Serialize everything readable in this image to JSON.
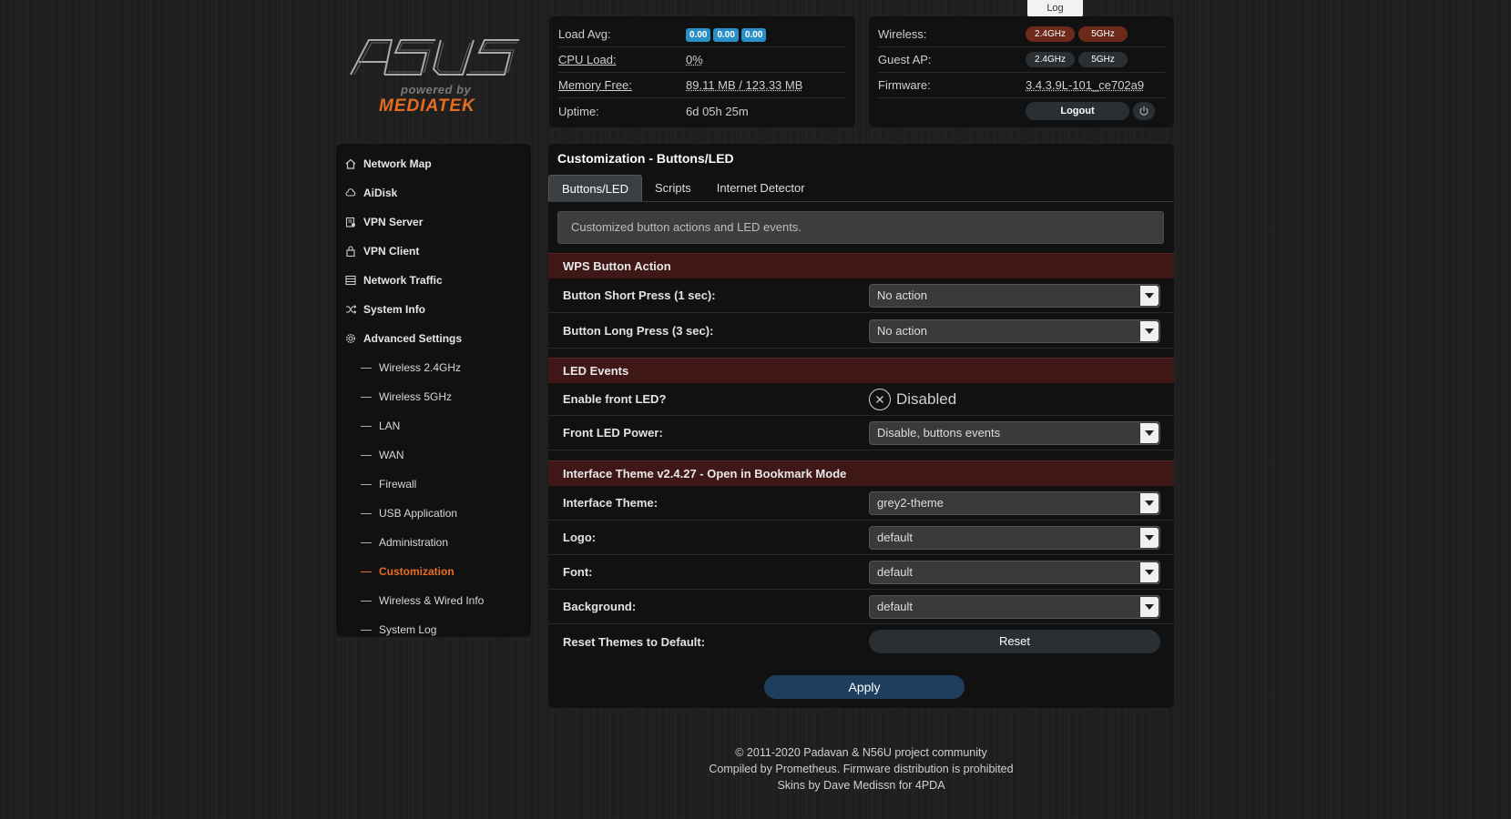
{
  "log_tab": "Log",
  "logo": {
    "brand": "ASUS",
    "powered_by": "powered by",
    "mediatek": "MEDIATEK"
  },
  "status": {
    "load_avg_label": "Load Avg:",
    "load_avg_values": [
      "0.00",
      "0.00",
      "0.00"
    ],
    "cpu_label": "CPU Load:",
    "cpu_value": "0%",
    "memory_label": "Memory Free:",
    "memory_value": "89.11 MB / 123.33 MB",
    "uptime_label": "Uptime:",
    "uptime_value": "6d 05h 25m",
    "wireless_label": "Wireless:",
    "wireless_24": "2.4GHz",
    "wireless_5": "5GHz",
    "guest_label": "Guest AP:",
    "guest_24": "2.4GHz",
    "guest_5": "5GHz",
    "firmware_label": "Firmware:",
    "firmware_value": "3.4.3.9L-101_ce702a9",
    "logout": "Logout"
  },
  "sidebar": {
    "items": [
      {
        "label": "Network Map",
        "icon": "home-icon"
      },
      {
        "label": "AiDisk",
        "icon": "cloud-icon"
      },
      {
        "label": "VPN Server",
        "icon": "vpn-server-icon"
      },
      {
        "label": "VPN Client",
        "icon": "vpn-client-icon"
      },
      {
        "label": "Network Traffic",
        "icon": "list-icon"
      },
      {
        "label": "System Info",
        "icon": "shuffle-icon"
      },
      {
        "label": "Advanced Settings",
        "icon": "gear-icon"
      }
    ],
    "subitems": [
      "Wireless 2.4GHz",
      "Wireless 5GHz",
      "LAN",
      "WAN",
      "Firewall",
      "USB Application",
      "Administration",
      "Customization",
      "Wireless & Wired Info",
      "System Log"
    ]
  },
  "main": {
    "title": "Customization - Buttons/LED",
    "tabs": [
      "Buttons/LED",
      "Scripts",
      "Internet Detector"
    ],
    "info": "Customized button actions and LED events.",
    "wps_section": "WPS Button Action",
    "short_press_label": "Button Short Press (1 sec):",
    "short_press_value": "No action",
    "long_press_label": "Button Long Press (3 sec):",
    "long_press_value": "No action",
    "led_section": "LED Events",
    "front_led_label": "Enable front LED?",
    "front_led_value": "Disabled",
    "led_power_label": "Front LED Power:",
    "led_power_value": "Disable, buttons events",
    "theme_section": "Interface Theme v2.4.27 - Open in Bookmark Mode",
    "theme_label": "Interface Theme:",
    "theme_value": "grey2-theme",
    "logo_label": "Logo:",
    "logo_value": "default",
    "font_label": "Font:",
    "font_value": "default",
    "background_label": "Background:",
    "background_value": "default",
    "reset_label": "Reset Themes to Default:",
    "reset_button": "Reset",
    "apply_button": "Apply"
  },
  "footer": {
    "line1": "© 2011-2020 Padavan & N56U project community",
    "line2": "Compiled by Prometheus. Firmware distribution is prohibited",
    "line3": "Skins by Dave Medissn for 4PDA"
  },
  "colors": {
    "accent": "#e96d1f",
    "section": "#3e1716",
    "badge": "#2a8fc7",
    "apply": "#1d3e5e"
  }
}
